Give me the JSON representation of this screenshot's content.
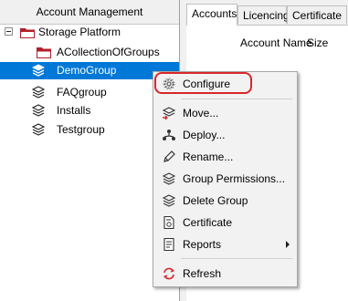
{
  "tree": {
    "header": "Account Management",
    "root": {
      "label": "Storage Platform",
      "expanded": true
    },
    "items": [
      {
        "label": "ACollectionOfGroups",
        "icon": "folder-icon"
      },
      {
        "label": "DemoGroup",
        "icon": "stack-icon",
        "selected": true
      },
      {
        "label": "FAQgroup",
        "icon": "stack-icon"
      },
      {
        "label": "Installs",
        "icon": "stack-icon"
      },
      {
        "label": "Testgroup",
        "icon": "stack-icon"
      }
    ]
  },
  "tabs": [
    {
      "label": "Accounts",
      "active": true
    },
    {
      "label": "Licencing",
      "active": false
    },
    {
      "label": "Certificate",
      "active": false
    }
  ],
  "columns": [
    "Account Name",
    "Size"
  ],
  "context_menu": {
    "items": [
      {
        "label": "Configure",
        "icon": "gear-icon",
        "highlighted": true
      },
      {
        "label": "Move...",
        "icon": "move-icon"
      },
      {
        "label": "Deploy...",
        "icon": "deploy-icon"
      },
      {
        "label": "Rename...",
        "icon": "rename-icon"
      },
      {
        "label": "Group Permissions...",
        "icon": "permissions-icon"
      },
      {
        "label": "Delete Group",
        "icon": "delete-group-icon"
      },
      {
        "label": "Certificate",
        "icon": "certificate-icon"
      },
      {
        "label": "Reports",
        "icon": "reports-icon",
        "submenu": true
      },
      {
        "label": "Refresh",
        "icon": "refresh-icon"
      }
    ]
  },
  "colors": {
    "selection": "#0078d7",
    "folder": "#b01f2a",
    "annotation": "#d8262a",
    "refresh": "#d8262a"
  }
}
